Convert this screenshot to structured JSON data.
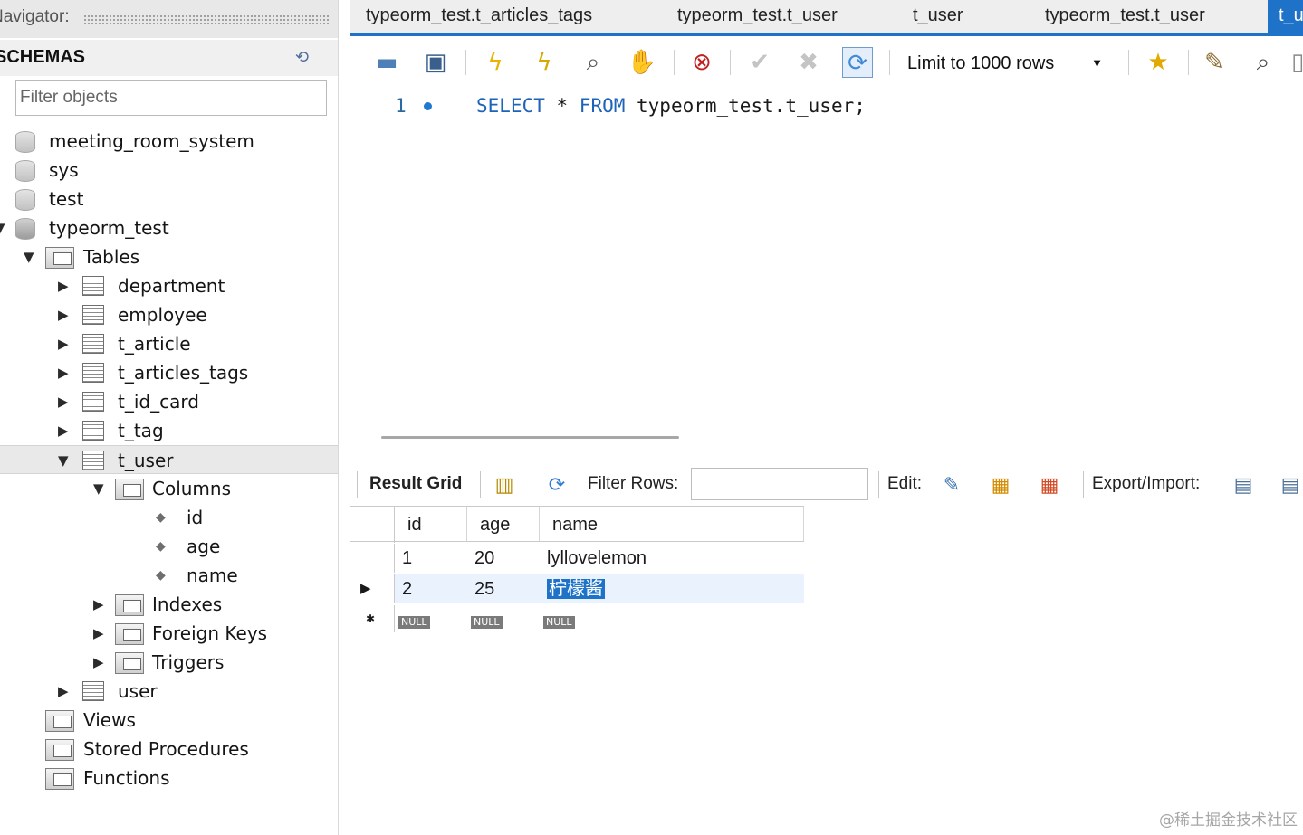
{
  "navigator": {
    "title": "Navigator:",
    "schemas_label": "SCHEMAS",
    "filter_placeholder": "Filter objects",
    "tree": {
      "schemas": [
        "meeting_room_system",
        "sys",
        "test",
        "typeorm_test"
      ],
      "tables_label": "Tables",
      "tables": [
        "department",
        "employee",
        "t_article",
        "t_articles_tags",
        "t_id_card",
        "t_tag",
        "t_user"
      ],
      "columns_label": "Columns",
      "columns": [
        "id",
        "age",
        "name"
      ],
      "indexes_label": "Indexes",
      "foreign_keys_label": "Foreign Keys",
      "triggers_label": "Triggers",
      "extra_table": "user",
      "views_label": "Views",
      "procedures_label": "Stored Procedures",
      "functions_label": "Functions"
    }
  },
  "tabs": [
    {
      "label": "typeorm_test.t_articles_tags",
      "active": false
    },
    {
      "label": "typeorm_test.t_user",
      "active": false
    },
    {
      "label": "t_user",
      "active": false
    },
    {
      "label": "typeorm_test.t_user",
      "active": false
    },
    {
      "label": "t_u",
      "active": true
    }
  ],
  "toolbar": {
    "limit_label": "Limit to 1000 rows"
  },
  "editor": {
    "line_number": "1",
    "kw_select": "SELECT",
    "star": " * ",
    "kw_from": "FROM",
    "rest": " typeorm_test.t_user;"
  },
  "result": {
    "grid_label": "Result Grid",
    "filter_label": "Filter Rows:",
    "edit_label": "Edit:",
    "export_label": "Export/Import:",
    "columns": [
      "id",
      "age",
      "name"
    ],
    "rows": [
      [
        "1",
        "20",
        "lyllovelemon"
      ],
      [
        "2",
        "25",
        "柠檬酱"
      ]
    ],
    "null_label": "NULL"
  },
  "watermark": "@稀土掘金技术社区",
  "colors": {
    "accent": "#1e73c8",
    "keyword": "#1d63b8"
  }
}
